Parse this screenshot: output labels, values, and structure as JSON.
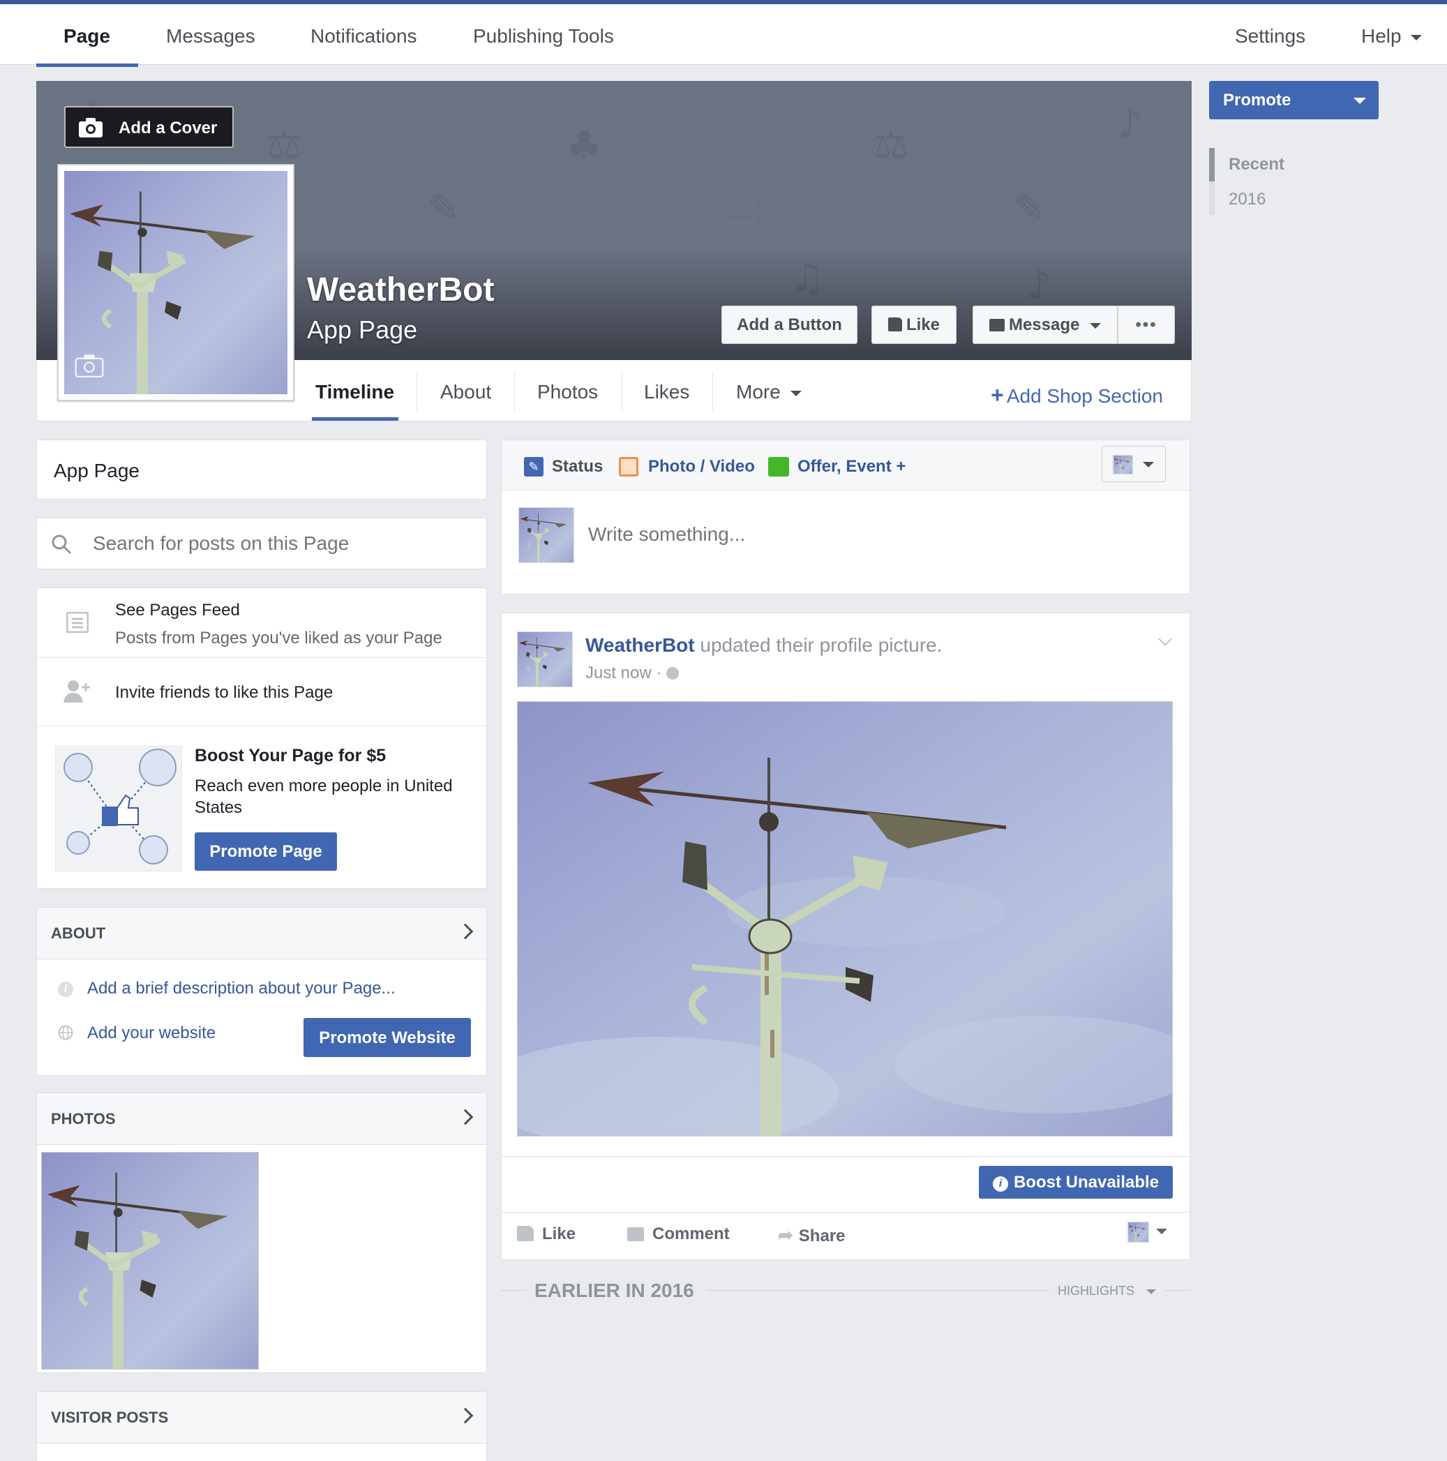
{
  "topnav": {
    "items": [
      "Page",
      "Messages",
      "Notifications",
      "Publishing Tools"
    ],
    "settings": "Settings",
    "help": "Help"
  },
  "sidebar_right": {
    "promote": "Promote",
    "years": [
      "Recent",
      "2016"
    ]
  },
  "cover": {
    "add_cover": "Add a Cover",
    "page_name": "WeatherBot",
    "page_category": "App Page",
    "buttons": {
      "add_button": "Add a Button",
      "like": "Like",
      "message": "Message",
      "more": "•••"
    }
  },
  "page_tabs": {
    "items": [
      "Timeline",
      "About",
      "Photos",
      "Likes",
      "More"
    ],
    "add_shop": "Add Shop Section"
  },
  "left": {
    "category": "App Page",
    "search_placeholder": "Search for posts on this Page",
    "pages_feed_title": "See Pages Feed",
    "pages_feed_sub": "Posts from Pages you've liked as your Page",
    "invite": "Invite friends to like this Page",
    "boost_title": "Boost Your Page for $5",
    "boost_text": "Reach even more people in United States",
    "promote_page": "Promote Page",
    "about_header": "ABOUT",
    "about_desc": "Add a brief description about your Page...",
    "about_website": "Add your website",
    "promote_website": "Promote Website",
    "photos_header": "PHOTOS",
    "visitor_header": "VISITOR POSTS"
  },
  "composer": {
    "tabs": [
      "Status",
      "Photo / Video",
      "Offer, Event +"
    ],
    "placeholder": "Write something..."
  },
  "post": {
    "author": "WeatherBot",
    "action": "updated their profile picture.",
    "time": "Just now",
    "boost": "Boost Unavailable",
    "like": "Like",
    "comment": "Comment",
    "share": "Share"
  },
  "divider": {
    "label": "EARLIER IN 2016",
    "highlights": "HIGHLIGHTS"
  },
  "colors": {
    "brand": "#4267b2",
    "top_border": "#3b5998",
    "link": "#365899"
  }
}
